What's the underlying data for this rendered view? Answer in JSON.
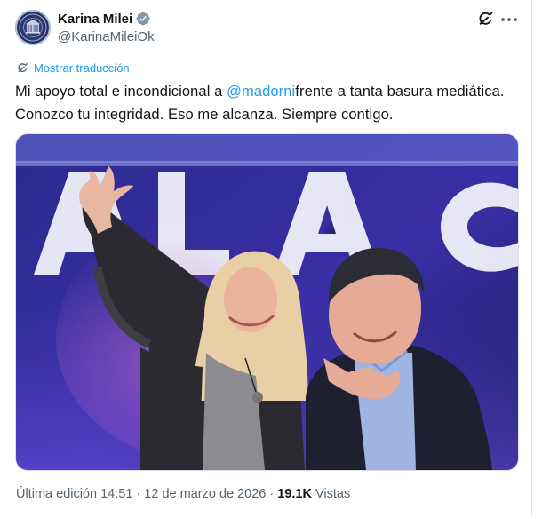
{
  "author": {
    "display_name": "Karina Milei",
    "handle": "@KarinaMileiOk",
    "verified_color": "#829aab"
  },
  "actions": {
    "grok_icon": "grok-icon",
    "more_icon": "more-icon"
  },
  "translate": {
    "label": "Mostrar traducción"
  },
  "tweet": {
    "text_before": "Mi apoyo total e incondicional a ",
    "mention": "@madorni",
    "text_after": "frente a tanta basura mediática. Conozco tu integridad. Eso me alcanza. Siempre contigo."
  },
  "media": {
    "kind": "photo",
    "background_letters": "ALAC"
  },
  "meta": {
    "edited_label": "Última edición",
    "time": "14:51",
    "separator": "·",
    "date": "12 de marzo de 2026",
    "views_count": "19.1K",
    "views_label": "Vistas"
  },
  "colors": {
    "link": "#1d9bf0",
    "secondary_text": "#536471",
    "primary_text": "#0f1419"
  }
}
